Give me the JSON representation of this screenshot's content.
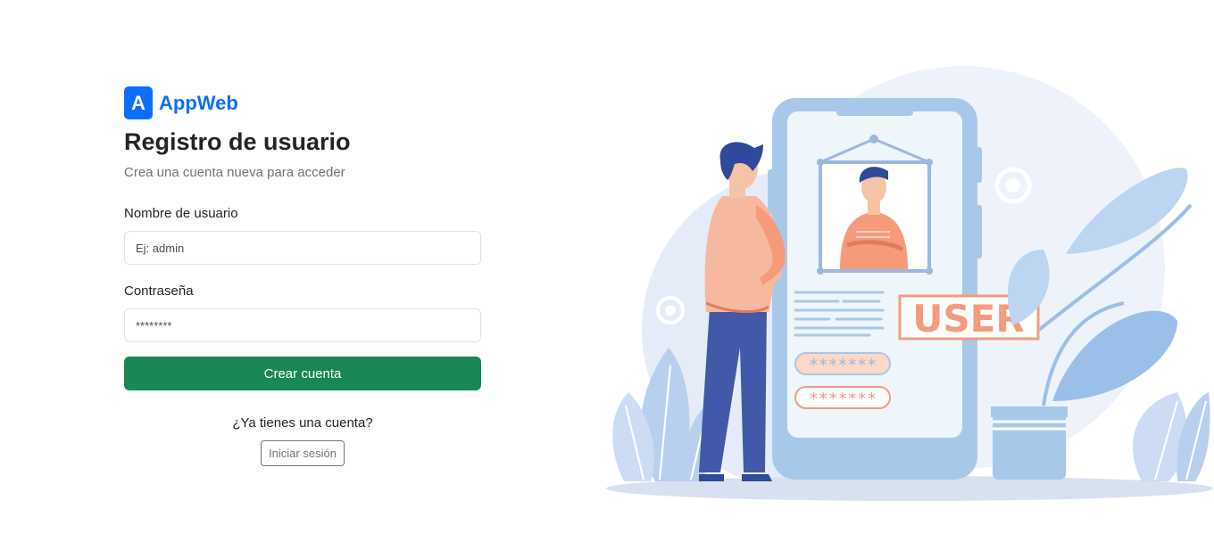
{
  "brand": {
    "logo_letter": "A",
    "name": "AppWeb"
  },
  "form": {
    "title": "Registro de usuario",
    "subtitle": "Crea una cuenta nueva para acceder",
    "username": {
      "label": "Nombre de usuario",
      "placeholder": "Ej: admin",
      "value": ""
    },
    "password": {
      "label": "Contraseña",
      "placeholder": "********",
      "value": ""
    },
    "submit_label": "Crear cuenta"
  },
  "footer": {
    "question": "¿Ya tienes una cuenta?",
    "login_label": "Iniciar sesión"
  },
  "illustration": {
    "badge_text": "USER",
    "password_mask": "*******",
    "colors": {
      "accent_primary": "#0d6efd",
      "accent_success": "#198754",
      "figure_salmon": "#f59b7c",
      "phone_blue": "#a8c8ea",
      "figure_navy": "#2f4a9a"
    }
  }
}
